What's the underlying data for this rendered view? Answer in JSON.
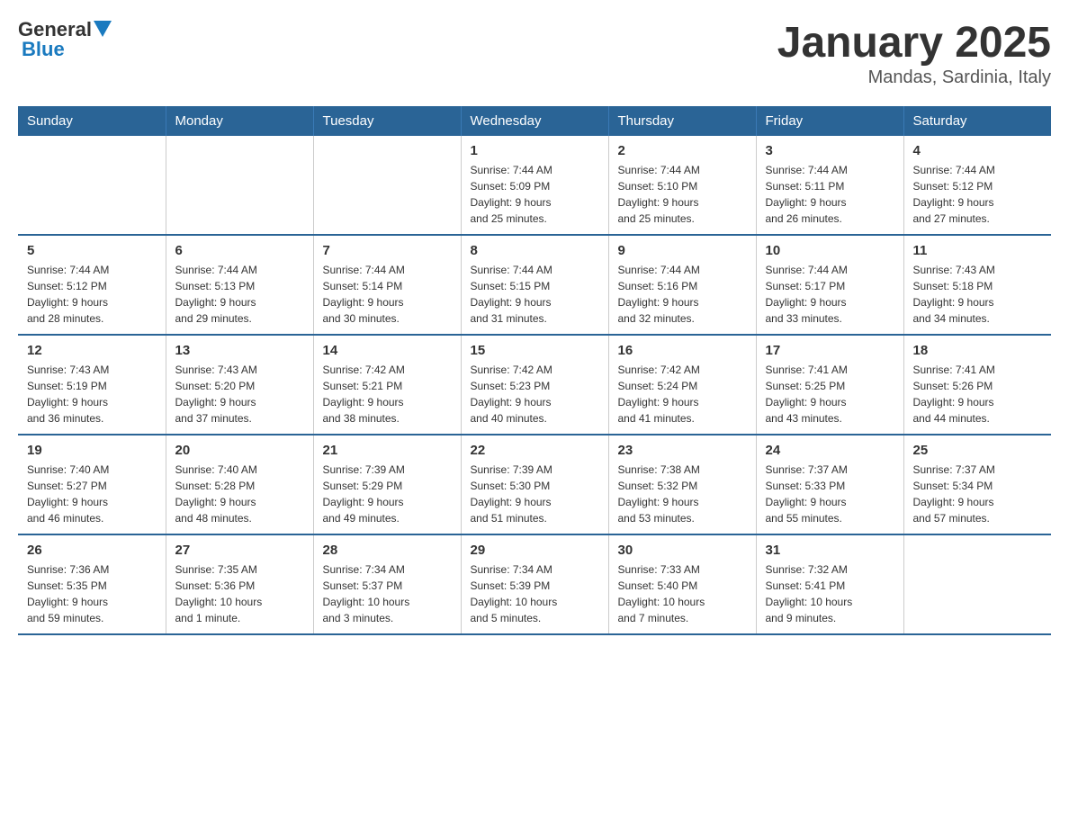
{
  "header": {
    "logo_text_black": "General",
    "logo_text_blue": "Blue",
    "month_year": "January 2025",
    "location": "Mandas, Sardinia, Italy"
  },
  "days_of_week": [
    "Sunday",
    "Monday",
    "Tuesday",
    "Wednesday",
    "Thursday",
    "Friday",
    "Saturday"
  ],
  "weeks": [
    [
      {
        "day": "",
        "info": ""
      },
      {
        "day": "",
        "info": ""
      },
      {
        "day": "",
        "info": ""
      },
      {
        "day": "1",
        "info": "Sunrise: 7:44 AM\nSunset: 5:09 PM\nDaylight: 9 hours\nand 25 minutes."
      },
      {
        "day": "2",
        "info": "Sunrise: 7:44 AM\nSunset: 5:10 PM\nDaylight: 9 hours\nand 25 minutes."
      },
      {
        "day": "3",
        "info": "Sunrise: 7:44 AM\nSunset: 5:11 PM\nDaylight: 9 hours\nand 26 minutes."
      },
      {
        "day": "4",
        "info": "Sunrise: 7:44 AM\nSunset: 5:12 PM\nDaylight: 9 hours\nand 27 minutes."
      }
    ],
    [
      {
        "day": "5",
        "info": "Sunrise: 7:44 AM\nSunset: 5:12 PM\nDaylight: 9 hours\nand 28 minutes."
      },
      {
        "day": "6",
        "info": "Sunrise: 7:44 AM\nSunset: 5:13 PM\nDaylight: 9 hours\nand 29 minutes."
      },
      {
        "day": "7",
        "info": "Sunrise: 7:44 AM\nSunset: 5:14 PM\nDaylight: 9 hours\nand 30 minutes."
      },
      {
        "day": "8",
        "info": "Sunrise: 7:44 AM\nSunset: 5:15 PM\nDaylight: 9 hours\nand 31 minutes."
      },
      {
        "day": "9",
        "info": "Sunrise: 7:44 AM\nSunset: 5:16 PM\nDaylight: 9 hours\nand 32 minutes."
      },
      {
        "day": "10",
        "info": "Sunrise: 7:44 AM\nSunset: 5:17 PM\nDaylight: 9 hours\nand 33 minutes."
      },
      {
        "day": "11",
        "info": "Sunrise: 7:43 AM\nSunset: 5:18 PM\nDaylight: 9 hours\nand 34 minutes."
      }
    ],
    [
      {
        "day": "12",
        "info": "Sunrise: 7:43 AM\nSunset: 5:19 PM\nDaylight: 9 hours\nand 36 minutes."
      },
      {
        "day": "13",
        "info": "Sunrise: 7:43 AM\nSunset: 5:20 PM\nDaylight: 9 hours\nand 37 minutes."
      },
      {
        "day": "14",
        "info": "Sunrise: 7:42 AM\nSunset: 5:21 PM\nDaylight: 9 hours\nand 38 minutes."
      },
      {
        "day": "15",
        "info": "Sunrise: 7:42 AM\nSunset: 5:23 PM\nDaylight: 9 hours\nand 40 minutes."
      },
      {
        "day": "16",
        "info": "Sunrise: 7:42 AM\nSunset: 5:24 PM\nDaylight: 9 hours\nand 41 minutes."
      },
      {
        "day": "17",
        "info": "Sunrise: 7:41 AM\nSunset: 5:25 PM\nDaylight: 9 hours\nand 43 minutes."
      },
      {
        "day": "18",
        "info": "Sunrise: 7:41 AM\nSunset: 5:26 PM\nDaylight: 9 hours\nand 44 minutes."
      }
    ],
    [
      {
        "day": "19",
        "info": "Sunrise: 7:40 AM\nSunset: 5:27 PM\nDaylight: 9 hours\nand 46 minutes."
      },
      {
        "day": "20",
        "info": "Sunrise: 7:40 AM\nSunset: 5:28 PM\nDaylight: 9 hours\nand 48 minutes."
      },
      {
        "day": "21",
        "info": "Sunrise: 7:39 AM\nSunset: 5:29 PM\nDaylight: 9 hours\nand 49 minutes."
      },
      {
        "day": "22",
        "info": "Sunrise: 7:39 AM\nSunset: 5:30 PM\nDaylight: 9 hours\nand 51 minutes."
      },
      {
        "day": "23",
        "info": "Sunrise: 7:38 AM\nSunset: 5:32 PM\nDaylight: 9 hours\nand 53 minutes."
      },
      {
        "day": "24",
        "info": "Sunrise: 7:37 AM\nSunset: 5:33 PM\nDaylight: 9 hours\nand 55 minutes."
      },
      {
        "day": "25",
        "info": "Sunrise: 7:37 AM\nSunset: 5:34 PM\nDaylight: 9 hours\nand 57 minutes."
      }
    ],
    [
      {
        "day": "26",
        "info": "Sunrise: 7:36 AM\nSunset: 5:35 PM\nDaylight: 9 hours\nand 59 minutes."
      },
      {
        "day": "27",
        "info": "Sunrise: 7:35 AM\nSunset: 5:36 PM\nDaylight: 10 hours\nand 1 minute."
      },
      {
        "day": "28",
        "info": "Sunrise: 7:34 AM\nSunset: 5:37 PM\nDaylight: 10 hours\nand 3 minutes."
      },
      {
        "day": "29",
        "info": "Sunrise: 7:34 AM\nSunset: 5:39 PM\nDaylight: 10 hours\nand 5 minutes."
      },
      {
        "day": "30",
        "info": "Sunrise: 7:33 AM\nSunset: 5:40 PM\nDaylight: 10 hours\nand 7 minutes."
      },
      {
        "day": "31",
        "info": "Sunrise: 7:32 AM\nSunset: 5:41 PM\nDaylight: 10 hours\nand 9 minutes."
      },
      {
        "day": "",
        "info": ""
      }
    ]
  ]
}
